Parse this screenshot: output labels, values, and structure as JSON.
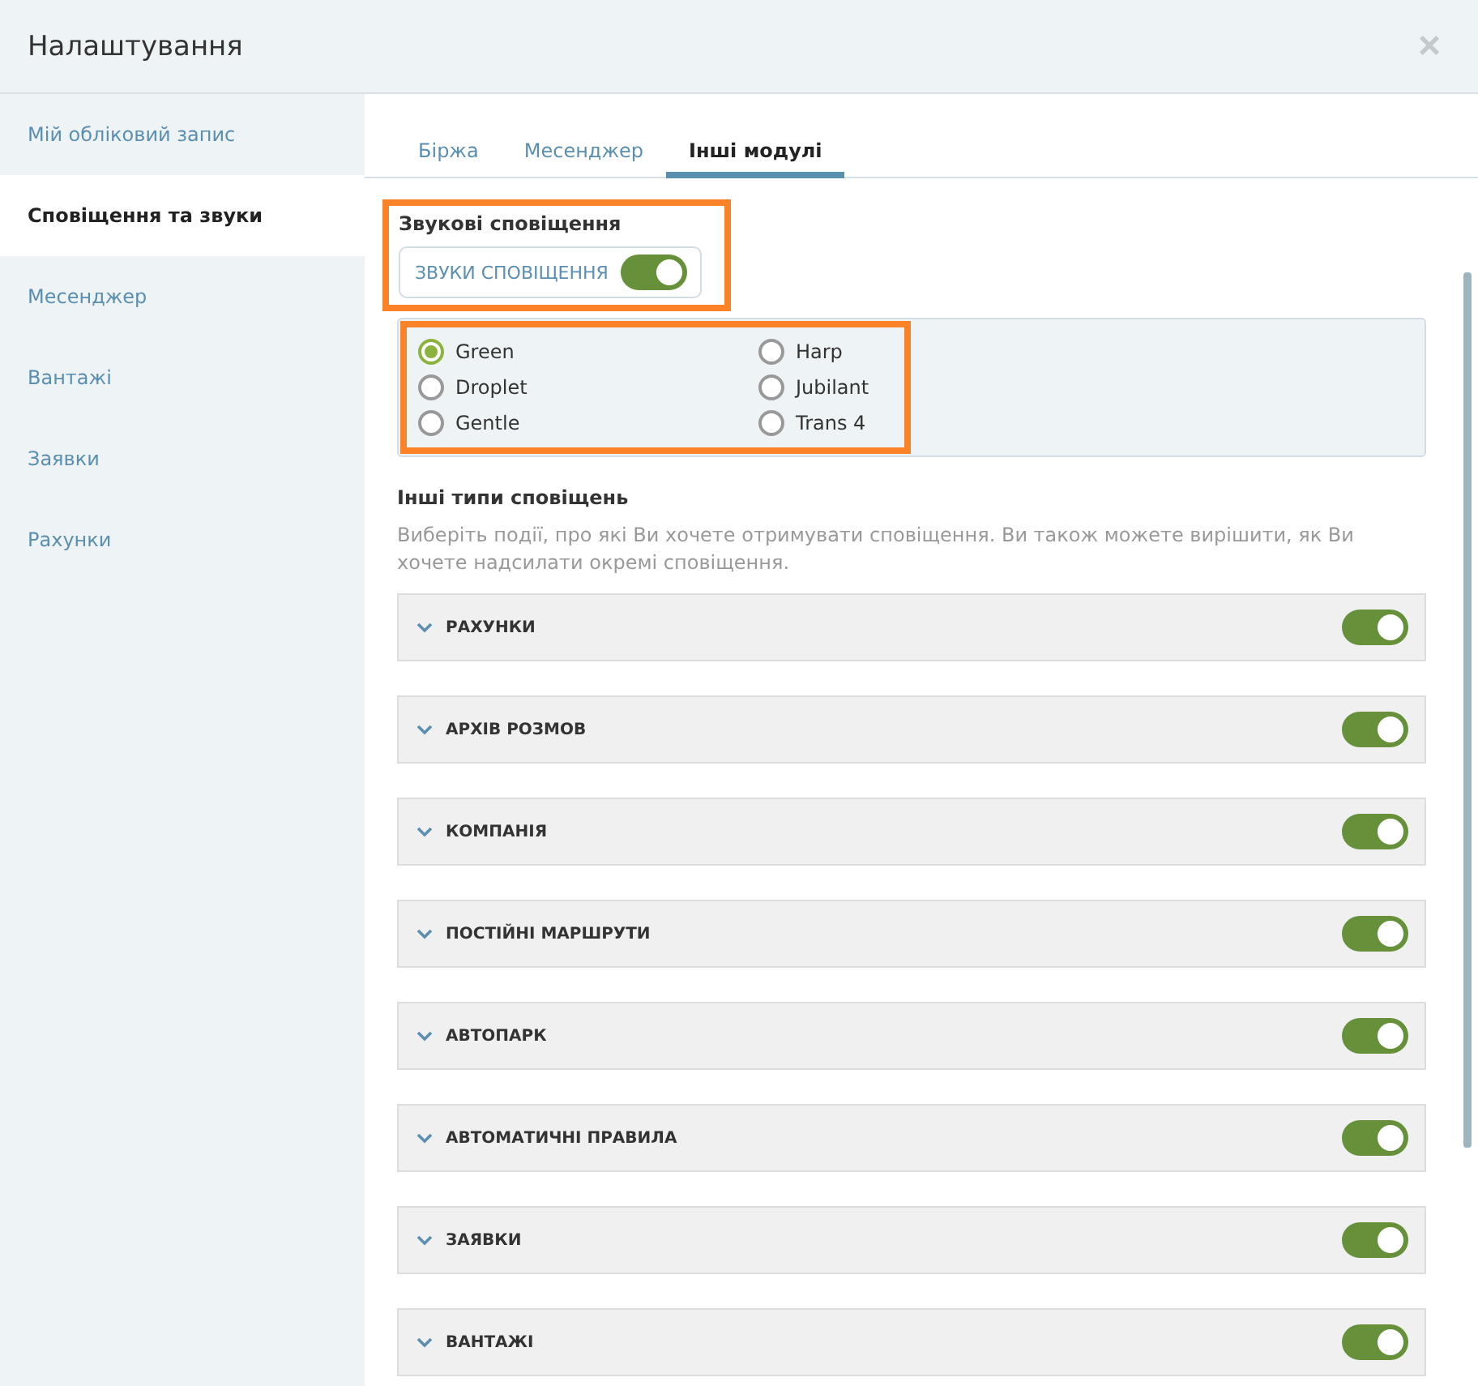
{
  "window": {
    "title": "Налаштування",
    "close": "×"
  },
  "sidebar": {
    "items": [
      {
        "label": "Мій обліковий запис",
        "selected": false
      },
      {
        "label": "Сповіщення та звуки",
        "selected": true
      },
      {
        "label": "Месенджер",
        "selected": false
      },
      {
        "label": "Вантажі",
        "selected": false
      },
      {
        "label": "Заявки",
        "selected": false
      },
      {
        "label": "Рахунки",
        "selected": false
      }
    ]
  },
  "tabs": [
    {
      "label": "Біржа",
      "selected": false
    },
    {
      "label": "Месенджер",
      "selected": false
    },
    {
      "label": "Інші модулі",
      "selected": true
    }
  ],
  "sound": {
    "title": "Звукові сповіщення",
    "toggle_label": "ЗВУКИ СПОВІЩЕННЯ",
    "on": true,
    "options": [
      {
        "label": "Green",
        "selected": true
      },
      {
        "label": "Harp",
        "selected": false
      },
      {
        "label": "Droplet",
        "selected": false
      },
      {
        "label": "Jubilant",
        "selected": false
      },
      {
        "label": "Gentle",
        "selected": false
      },
      {
        "label": "Trans 4",
        "selected": false
      }
    ]
  },
  "other": {
    "title": "Інші типи сповіщень",
    "description": "Виберіть події, про які Ви хочете отримувати сповіщення. Ви також можете вирішити, як Ви хочете надсилати окремі сповіщення.",
    "sections": [
      {
        "label": "РАХУНКИ",
        "expanded": false,
        "on": true
      },
      {
        "label": "АРХІВ РОЗМОВ",
        "expanded": false,
        "on": true
      },
      {
        "label": "КОМПАНІЯ",
        "expanded": false,
        "on": true
      },
      {
        "label": "ПОСТІЙНІ МАРШРУТИ",
        "expanded": false,
        "on": true
      },
      {
        "label": "АВТОПАРК",
        "expanded": false,
        "on": true
      },
      {
        "label": "АВТОМАТИЧНІ ПРАВИЛА",
        "expanded": false,
        "on": true
      },
      {
        "label": "ЗАЯВКИ",
        "expanded": false,
        "on": true
      },
      {
        "label": "ВАНТАЖІ",
        "expanded": false,
        "on": true
      }
    ]
  }
}
